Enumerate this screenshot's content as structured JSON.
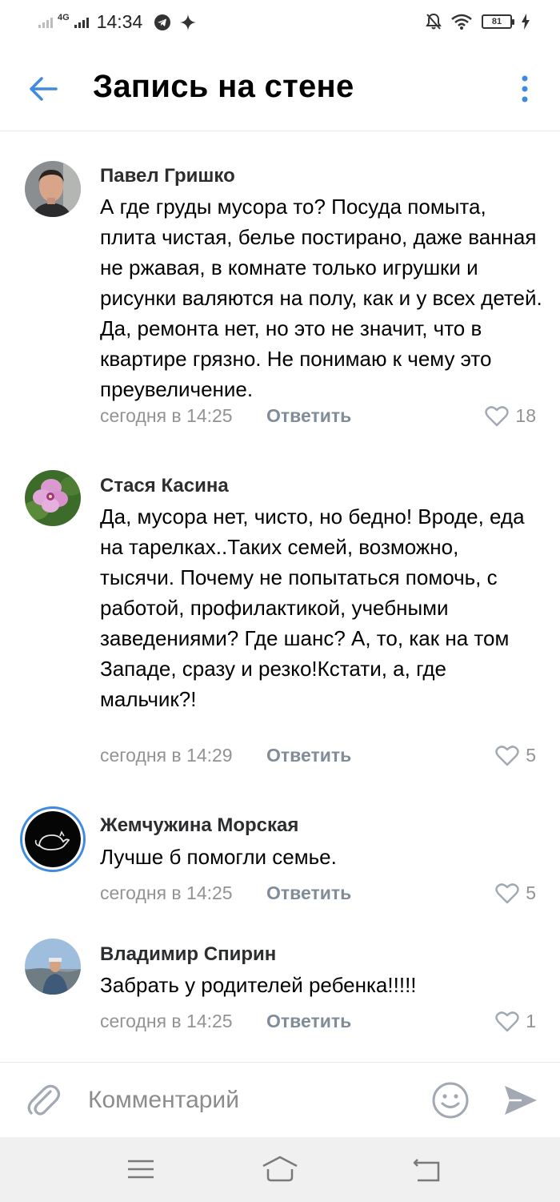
{
  "status_bar": {
    "network": "4G",
    "time": "14:34",
    "battery": "81"
  },
  "header": {
    "title": "Запись на стене"
  },
  "comments": [
    {
      "author": "Павел Гришко",
      "text": "А где груды мусора то? Посуда помыта, плита чистая, белье постирано, даже ванная не ржавая, в комнате только игрушки и рисунки валяются на полу, как и у всех детей. Да, ремонта нет, но это не значит, что в квартире грязно. Не понимаю к чему это преувеличение.",
      "date": "сегодня в 14:25",
      "reply_label": "Ответить",
      "likes": "18"
    },
    {
      "author": "Стася Касина",
      "text": "Да, мусора нет, чисто, но бедно! Вроде, еда на тарелках..Таких семей, возможно, тысячи. Почему не попытаться помочь, с работой, профилактикой, учебными заведениями? Где шанс? А, то, как на том Западе, сразу и резко!Кстати, а, где мальчик?!",
      "date": "сегодня в 14:29",
      "reply_label": "Ответить",
      "likes": "5"
    },
    {
      "author": "Жемчужина Морская",
      "text": "Лучше б помогли семье.",
      "date": "сегодня в 14:25",
      "reply_label": "Ответить",
      "likes": "5"
    },
    {
      "author": "Владимир Спирин",
      "text": "Забрать у родителей ребенка!!!!!",
      "date": "сегодня в 14:25",
      "reply_label": "Ответить",
      "likes": "1"
    }
  ],
  "composer": {
    "placeholder": "Комментарий"
  },
  "colors": {
    "accent": "#3f8ae0",
    "secondary_text": "#939393",
    "reply_text": "#818c99",
    "icon_gray": "#a3a9b3"
  },
  "icons": {
    "back": "arrow-left-icon",
    "more": "more-vertical-icon",
    "like": "heart-icon",
    "attach": "paperclip-icon",
    "emoji": "smile-icon",
    "send": "send-icon"
  }
}
